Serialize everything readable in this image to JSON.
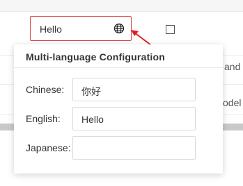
{
  "cell": {
    "value": "Hello",
    "globe_icon": "globe-icon"
  },
  "background_rows": [
    {
      "suffix": "and"
    },
    {
      "suffix": "odel"
    }
  ],
  "popover": {
    "title": "Multi-language Configuration",
    "languages": [
      {
        "label": "Chinese:",
        "value": "你好"
      },
      {
        "label": "English:",
        "value": "Hello"
      },
      {
        "label": "Japanese:",
        "value": ""
      }
    ]
  },
  "colors": {
    "accent_red": "#d94646"
  }
}
